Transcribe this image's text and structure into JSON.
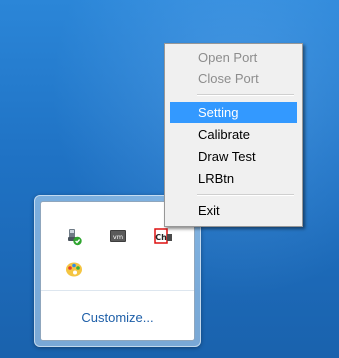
{
  "tray_flyout": {
    "customize_label": "Customize...",
    "icons": [
      {
        "name": "usb-safely-remove-icon"
      },
      {
        "name": "vmware-tools-icon",
        "text": "vm"
      },
      {
        "name": "touch-app-icon",
        "text": "Ch"
      },
      {
        "name": "paint-palette-icon"
      }
    ]
  },
  "context_menu": {
    "items": [
      {
        "label": "Open Port",
        "state": "disabled"
      },
      {
        "label": "Close Port",
        "state": "disabled"
      },
      {
        "label": "Setting",
        "state": "highlighted"
      },
      {
        "label": "Calibrate",
        "state": "enabled"
      },
      {
        "label": "Draw Test",
        "state": "enabled"
      },
      {
        "label": "LRBtn",
        "state": "enabled"
      },
      {
        "label": "Exit",
        "state": "enabled"
      }
    ]
  },
  "colors": {
    "highlight": "#3399ff",
    "disabled_text": "#8d8d8d",
    "link": "#1e5fa8"
  }
}
